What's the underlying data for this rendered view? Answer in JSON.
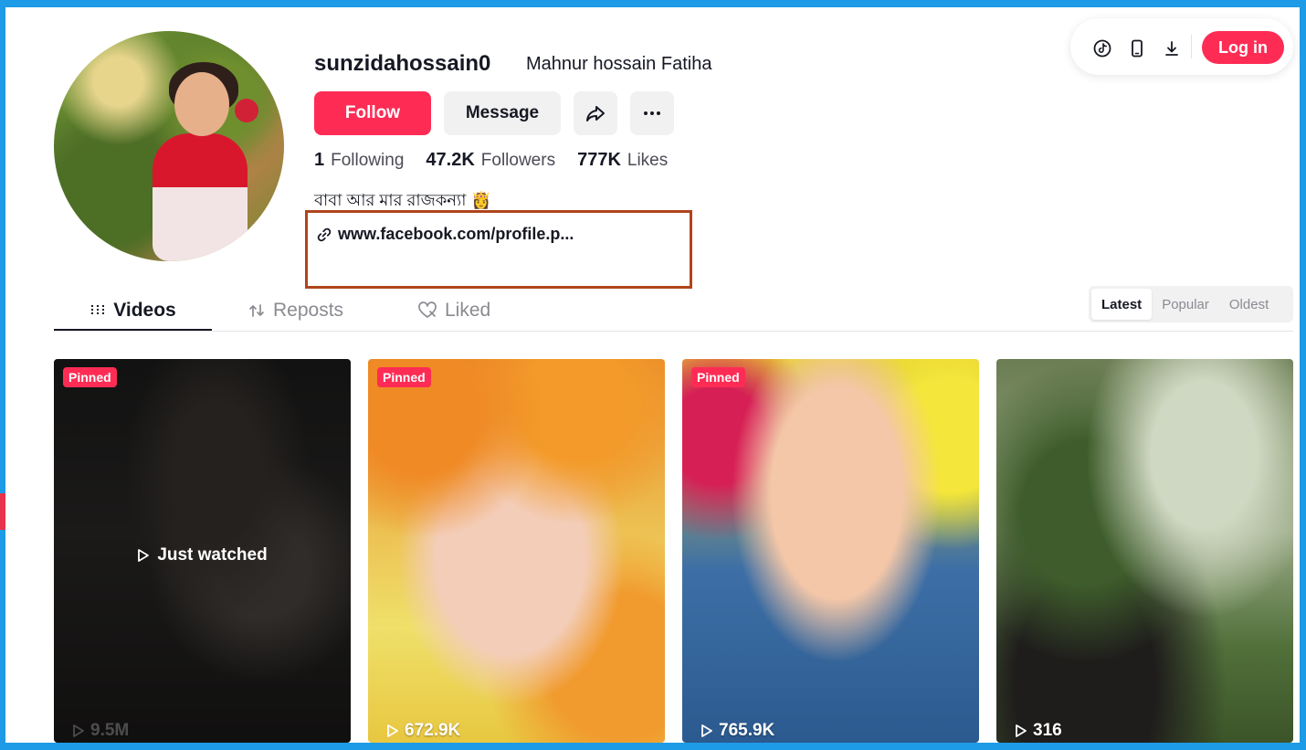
{
  "profile": {
    "username": "sunzidahossain0",
    "nickname": "Mahnur hossain Fatiha",
    "follow_label": "Follow",
    "message_label": "Message",
    "stats": {
      "following_count": "1",
      "following_label": "Following",
      "followers_count": "47.2K",
      "followers_label": "Followers",
      "likes_count": "777K",
      "likes_label": "Likes"
    },
    "bio": "বাবা আর মার রাজকন্যা 👸",
    "link": "www.facebook.com/profile.p..."
  },
  "topbar": {
    "icons": [
      "tiktok-icon",
      "phone-icon",
      "download-icon"
    ],
    "login_label": "Log in"
  },
  "tabs": [
    {
      "label": "Videos",
      "active": true
    },
    {
      "label": "Reposts",
      "active": false
    },
    {
      "label": "Liked",
      "active": false
    }
  ],
  "sort": {
    "options": [
      "Latest",
      "Popular",
      "Oldest"
    ],
    "selected": "Latest"
  },
  "videos": [
    {
      "pinned_label": "Pinned",
      "views": "9.5M",
      "overlay": "Just watched"
    },
    {
      "pinned_label": "Pinned",
      "views": "672.9K"
    },
    {
      "pinned_label": "Pinned",
      "views": "765.9K"
    },
    {
      "views": "316"
    }
  ],
  "colors": {
    "accent": "#fe2c55",
    "highlight_box": "#b0441c",
    "frame": "#1e9be6"
  }
}
